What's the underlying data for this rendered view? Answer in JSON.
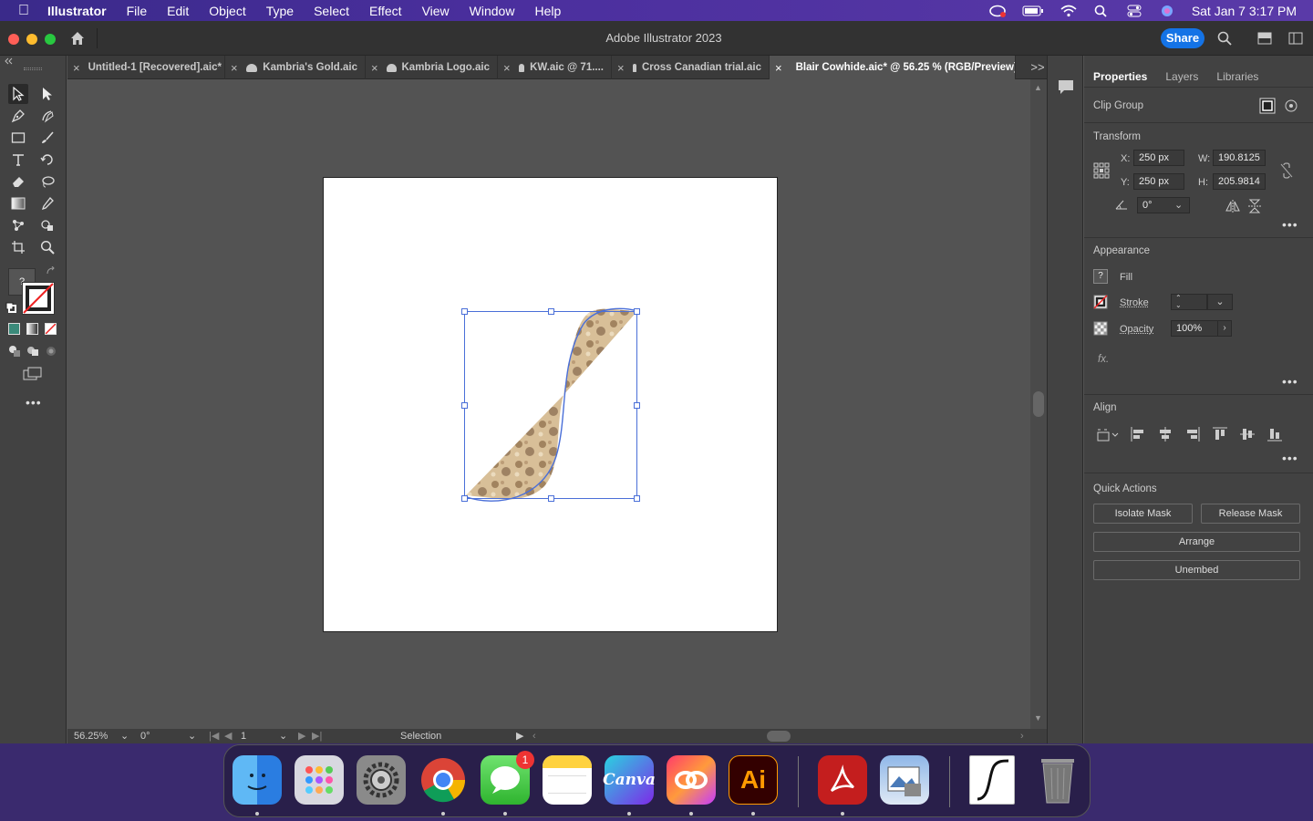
{
  "menubar": {
    "app": "Illustrator",
    "items": [
      "File",
      "Edit",
      "Object",
      "Type",
      "Select",
      "Effect",
      "View",
      "Window",
      "Help"
    ],
    "clock": "Sat Jan 7  3:17 PM"
  },
  "window": {
    "title": "Adobe Illustrator 2023",
    "share_label": "Share"
  },
  "tabs": [
    {
      "label": "Untitled-1 [Recovered].aic*",
      "cloud": false,
      "active": false
    },
    {
      "label": "Kambria's Gold.aic",
      "cloud": true,
      "active": false
    },
    {
      "label": "Kambria Logo.aic",
      "cloud": true,
      "active": false
    },
    {
      "label": "KW.aic @ 71....",
      "cloud": true,
      "active": false
    },
    {
      "label": "Cross Canadian trial.aic",
      "cloud": true,
      "active": false
    },
    {
      "label": "Blair Cowhide.aic* @ 56.25 % (RGB/Preview)",
      "cloud": true,
      "active": true
    }
  ],
  "statusbar": {
    "zoom": "56.25%",
    "rotation": "0°",
    "artboard": "1",
    "tool": "Selection"
  },
  "panel": {
    "tabs": [
      "Properties",
      "Layers",
      "Libraries"
    ],
    "selection_type": "Clip Group",
    "transform": {
      "heading": "Transform",
      "x_label": "X:",
      "x": "250 px",
      "y_label": "Y:",
      "y": "250 px",
      "w_label": "W:",
      "w": "190.8125",
      "h_label": "H:",
      "h": "205.9814",
      "angle": "0°"
    },
    "appearance": {
      "heading": "Appearance",
      "fill": "Fill",
      "stroke": "Stroke",
      "opacity_label": "Opacity",
      "opacity": "100%",
      "fx": "fx."
    },
    "align": {
      "heading": "Align"
    },
    "quick_actions": {
      "heading": "Quick Actions",
      "isolate": "Isolate Mask",
      "release": "Release Mask",
      "arrange": "Arrange",
      "unembed": "Unembed"
    }
  },
  "dock": {
    "canva": "Canva",
    "ai": "Ai",
    "messages_badge": "1"
  },
  "colors": {
    "accent": "#1473e6",
    "selection": "#4a6fd8"
  }
}
